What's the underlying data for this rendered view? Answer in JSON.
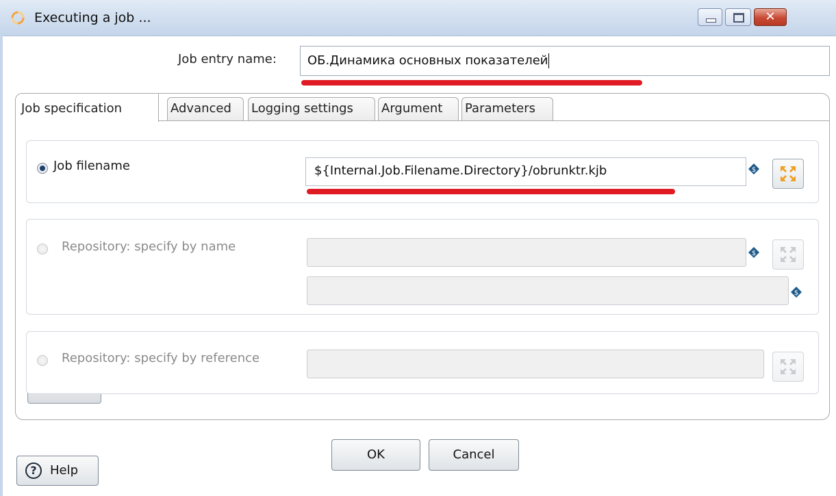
{
  "window": {
    "title": "Executing a job ...",
    "close_glyph": "✕"
  },
  "job_entry": {
    "label": "Job entry name:",
    "value": "ОБ.Динамика основных показателей"
  },
  "tabs": [
    {
      "label": "Job specification",
      "active": true
    },
    {
      "label": "Advanced",
      "active": false
    },
    {
      "label": "Logging settings",
      "active": false
    },
    {
      "label": "Argument",
      "active": false
    },
    {
      "label": "Parameters",
      "active": false
    }
  ],
  "job_spec": {
    "filename": {
      "label": "Job filename",
      "value": "${Internal.Job.Filename.Directory}/obrunktr.kjb",
      "selected": true
    },
    "repo_by_name": {
      "label": "Repository: specify by name",
      "directory_value": "",
      "name_value": "",
      "selected": false
    },
    "repo_by_reference": {
      "label": "Repository: specify by reference",
      "value": "",
      "selected": false
    }
  },
  "buttons": {
    "ok": "OK",
    "cancel": "Cancel",
    "help": "Help",
    "help_glyph": "?"
  },
  "icons": {
    "app": "spinner-icon",
    "variable": "variable-dollar-icon",
    "browse": "browse-arrows-icon",
    "help": "help-circle-icon"
  },
  "colors": {
    "highlight_underline": "#e01b24",
    "title_gradient_top": "#e2ebf6",
    "radio_selected": "#1f3f6e",
    "browse_arrows": "#f0a020",
    "variable_icon": "#1e5a8a"
  }
}
